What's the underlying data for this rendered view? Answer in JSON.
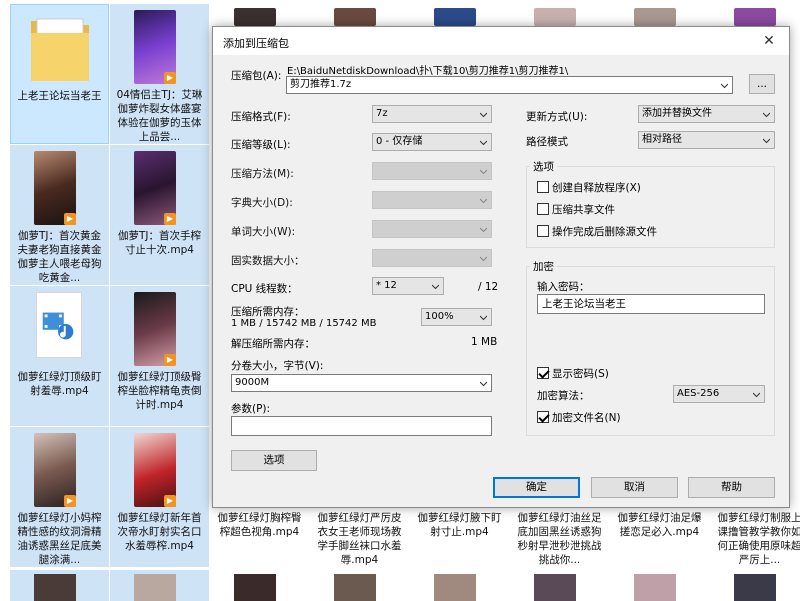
{
  "explorer": {
    "tiles": [
      {
        "caption": "上老王论坛当老王",
        "kind": "folder"
      },
      {
        "caption": "04情侣主TJ：艾琳伽萝炸裂女体盛宴体验在伽萝的玉体上品尝...",
        "kind": "video"
      },
      {
        "caption": "伽萝TJ：首次黄金夫妻老狗直接黄金伽萝主人喂老母狗吃黄金...",
        "kind": "video"
      },
      {
        "caption": "伽萝TJ：首次手榨寸止十次.mp4",
        "kind": "video"
      },
      {
        "caption": "伽萝红绿灯顶级盯射羞辱.mp4",
        "kind": "file"
      },
      {
        "caption": "伽萝红绿灯顶级臀榨坐脸榨精龟责倒计时.mp4",
        "kind": "video"
      },
      {
        "caption": "伽萝红绿灯小妈榨精性感的纹洞滑精油诱惑黑丝足底美腿涂满...",
        "kind": "video"
      },
      {
        "caption": "伽萝红绿灯新年首次帝水盯射实名口水羞辱榨.mp4",
        "kind": "video"
      },
      {
        "caption": "伽萝红绿灯胸榨臀榨超色视角.mp4",
        "kind": "video"
      },
      {
        "caption": "伽萝红绿灯严厉皮衣女王老师现场教学手脚丝袜口水羞辱.mp4",
        "kind": "video"
      },
      {
        "caption": "伽萝红绿灯腋下盯射寸止.mp4",
        "kind": "video"
      },
      {
        "caption": "伽萝红绿灯油丝足底加固黑丝诱惑狗秒射早泄秒泄挑战挑战你...",
        "kind": "video"
      },
      {
        "caption": "伽萝红绿灯油足爆搓恋足必入.mp4",
        "kind": "video"
      },
      {
        "caption": "伽萝红绿灯制服上课撸管教学教你如何正确使用原味超严厉上...",
        "kind": "video"
      }
    ]
  },
  "dialog": {
    "title": "添加到压缩包",
    "close_glyph": "✕",
    "archive_label": "压缩包(A):",
    "archive_path": "E:\\BaiduNetdiskDownload\\扑\\下载10\\剪刀推荐1\\剪刀推荐1\\",
    "archive_name": "剪刀推荐1.7z",
    "browse_label": "...",
    "format_label": "压缩格式(F):",
    "format_value": "7z",
    "level_label": "压缩等级(L):",
    "level_value": "0 - 仅存储",
    "method_label": "压缩方法(M):",
    "dict_label": "字典大小(D):",
    "word_label": "单词大小(W):",
    "solid_label": "固实数据大小：",
    "cpu_label": "CPU 线程数：",
    "cpu_value": "* 12",
    "cpu_max": "/ 12",
    "mem_comp_label": "压缩所需内存：",
    "mem_comp_value": "1 MB / 15742 MB / 15742 MB",
    "mem_percent": "100%",
    "mem_decomp_label": "解压缩所需内存：",
    "mem_decomp_value": "1 MB",
    "split_label": "分卷大小，字节(V):",
    "split_value": "9000M",
    "params_label": "参数(P):",
    "params_value": "",
    "options_btn": "选项",
    "update_label": "更新方式(U):",
    "update_value": "添加并替换文件",
    "pathmode_label": "路径模式",
    "pathmode_value": "相对路径",
    "options_group": "选项",
    "opt_sfx": "创建自释放程序(X)",
    "opt_shared": "压缩共享文件",
    "opt_delete": "操作完成后删除源文件",
    "enc_group": "加密",
    "pwd_label": "输入密码：",
    "pwd_value": "上老王论坛当老王",
    "show_pwd": "显示密码(S)",
    "enc_method_label": "加密算法：",
    "enc_method_value": "AES-256",
    "enc_names": "加密文件名(N)",
    "ok": "确定",
    "cancel": "取消",
    "help": "帮助"
  }
}
